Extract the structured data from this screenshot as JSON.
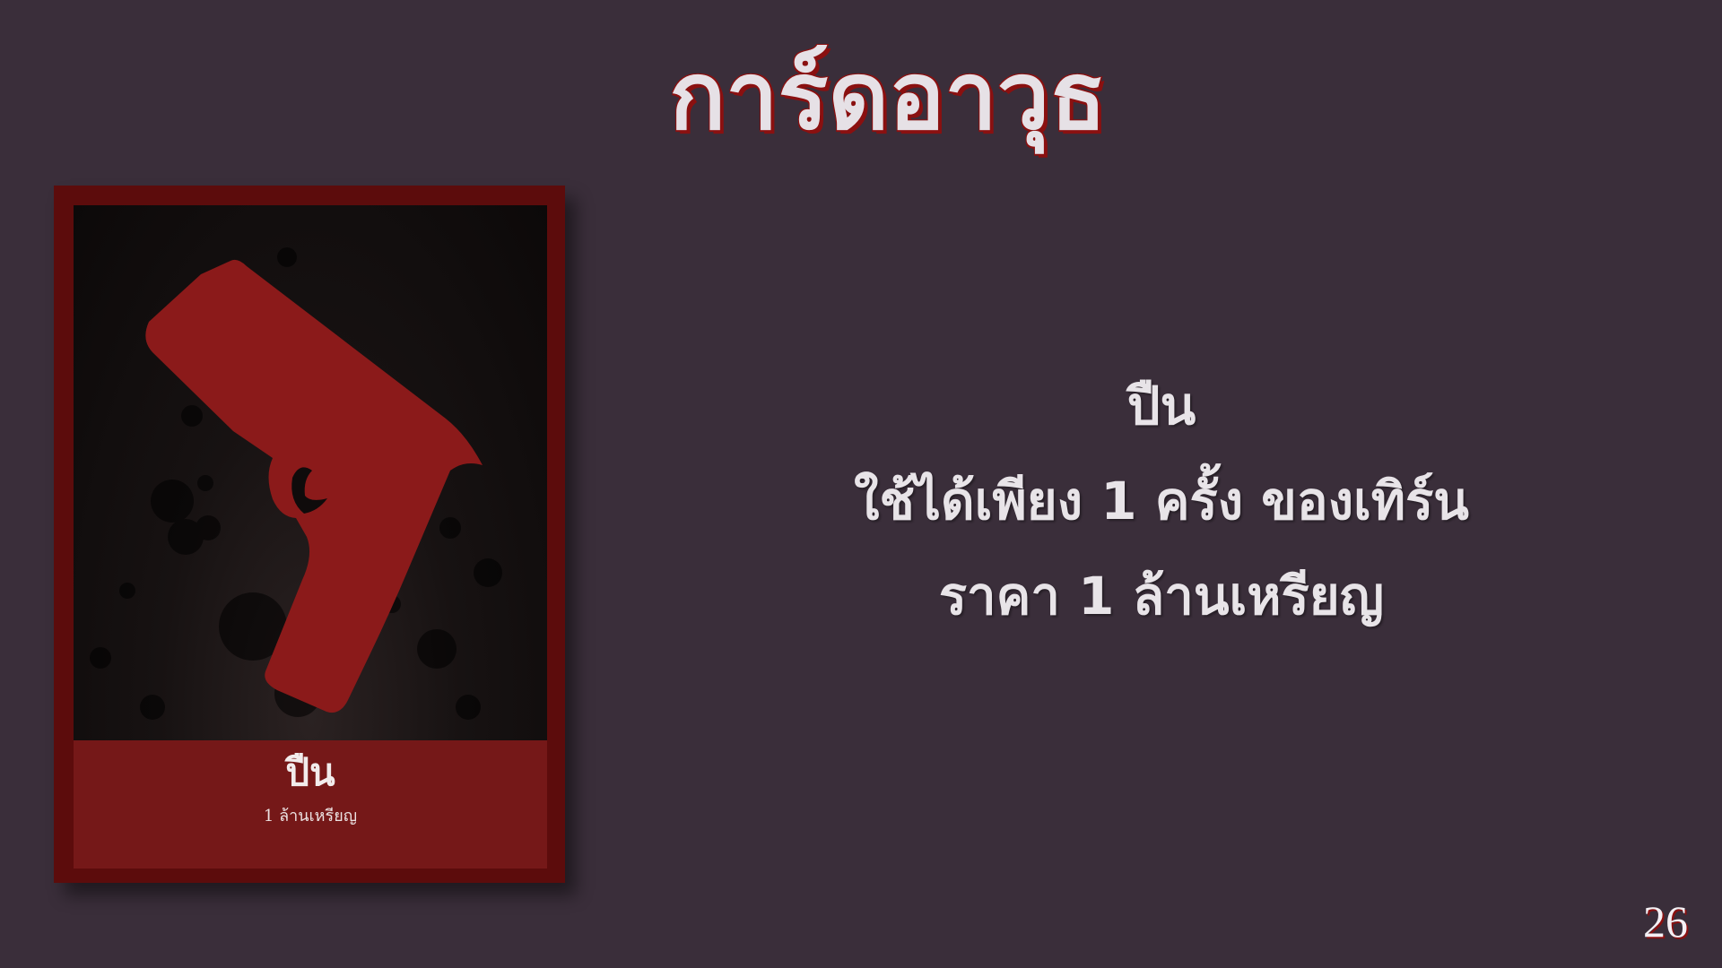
{
  "slide": {
    "title": "การ์ดอาวุธ",
    "page_number": "26"
  },
  "card": {
    "icon": "gun-icon",
    "name": "ปืน",
    "price": "1 ล้านเหรียญ",
    "colors": {
      "frame": "#5c0c0c",
      "footer": "#751818",
      "gun": "#8b1a1a"
    }
  },
  "description": {
    "lines": [
      "ปืน",
      "ใช้ได้เพียง 1 ครั้ง ของเทิร์น",
      "ราคา 1 ล้านเหรียญ"
    ]
  },
  "colors": {
    "background": "#3a2e3a",
    "title_shadow": "#8a1010",
    "text": "#e8e4e8"
  }
}
